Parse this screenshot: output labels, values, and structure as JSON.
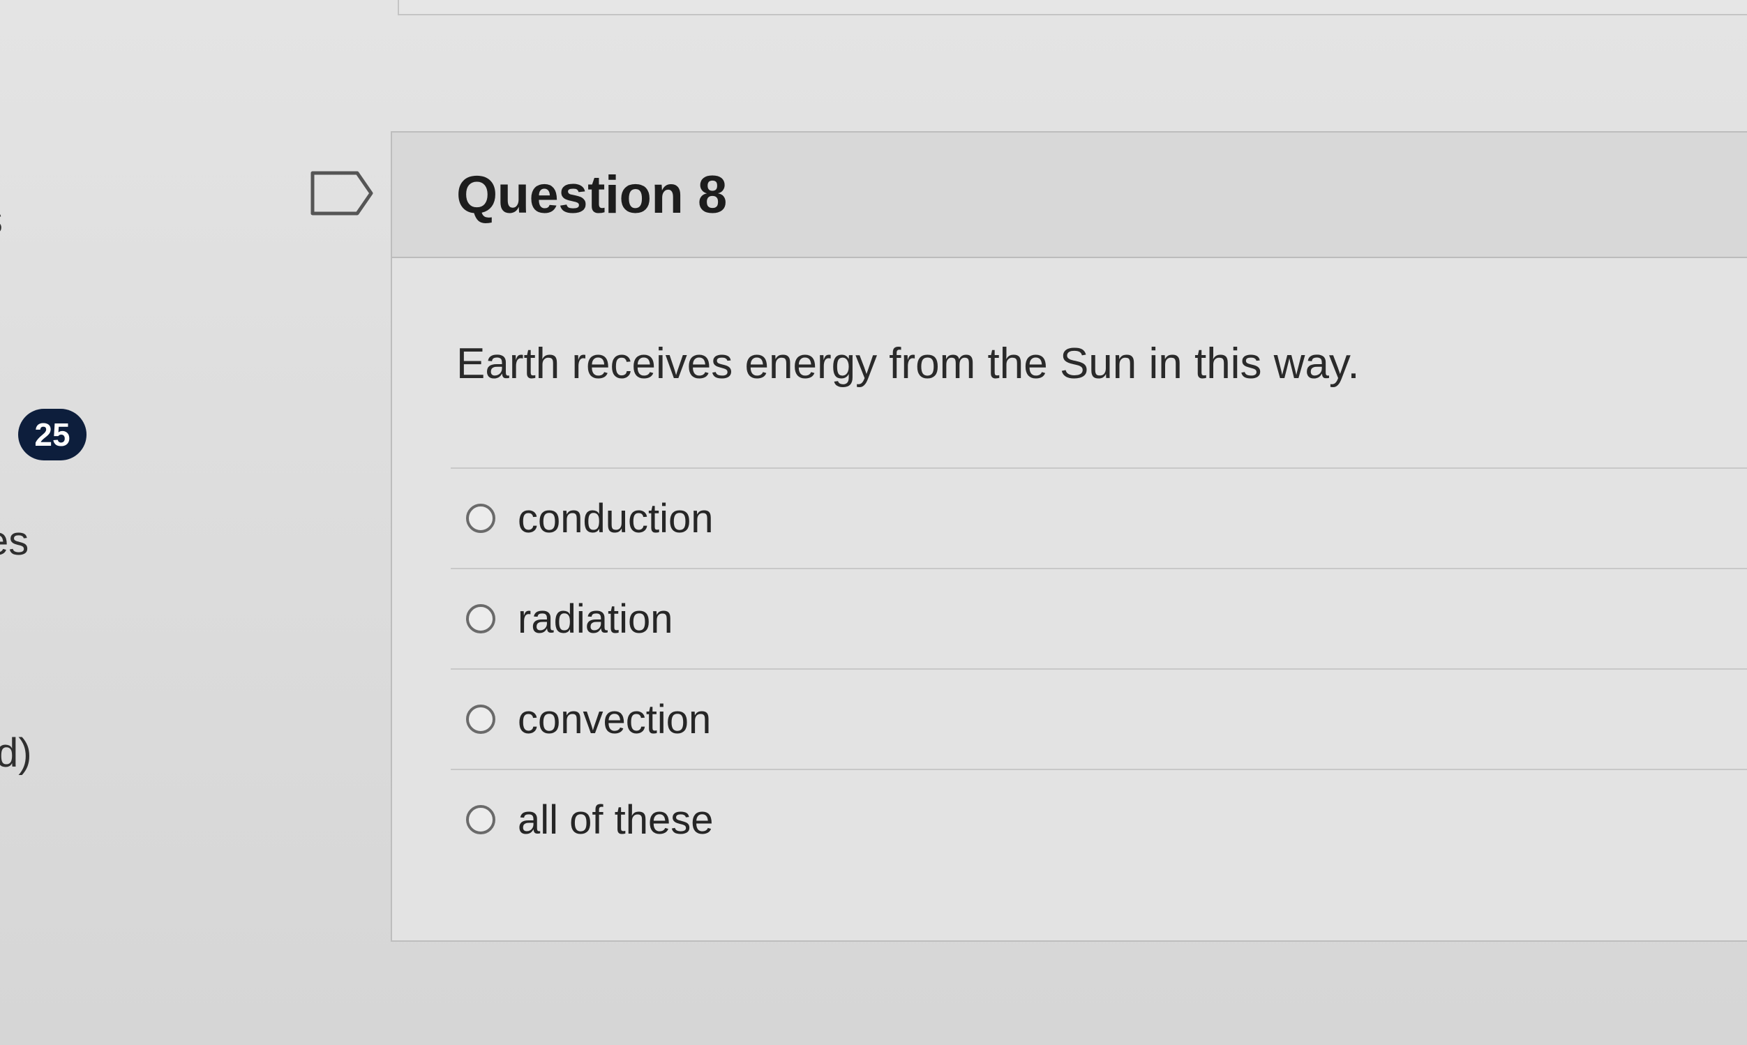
{
  "sidebar": {
    "fragment_top": "s",
    "fragment_middle": "es",
    "fragment_bottom": "d)",
    "badge_count": "25"
  },
  "question": {
    "title": "Question 8",
    "prompt": "Earth receives energy from the Sun in this way.",
    "flag_icon": "flag-outline-icon",
    "answers": [
      {
        "label": "conduction",
        "selected": false
      },
      {
        "label": "radiation",
        "selected": false
      },
      {
        "label": "convection",
        "selected": false
      },
      {
        "label": "all of these",
        "selected": false
      }
    ]
  },
  "colors": {
    "badge_bg": "#0d1e3c",
    "header_bg": "#d8d8d8",
    "card_bg": "#e3e3e3"
  }
}
